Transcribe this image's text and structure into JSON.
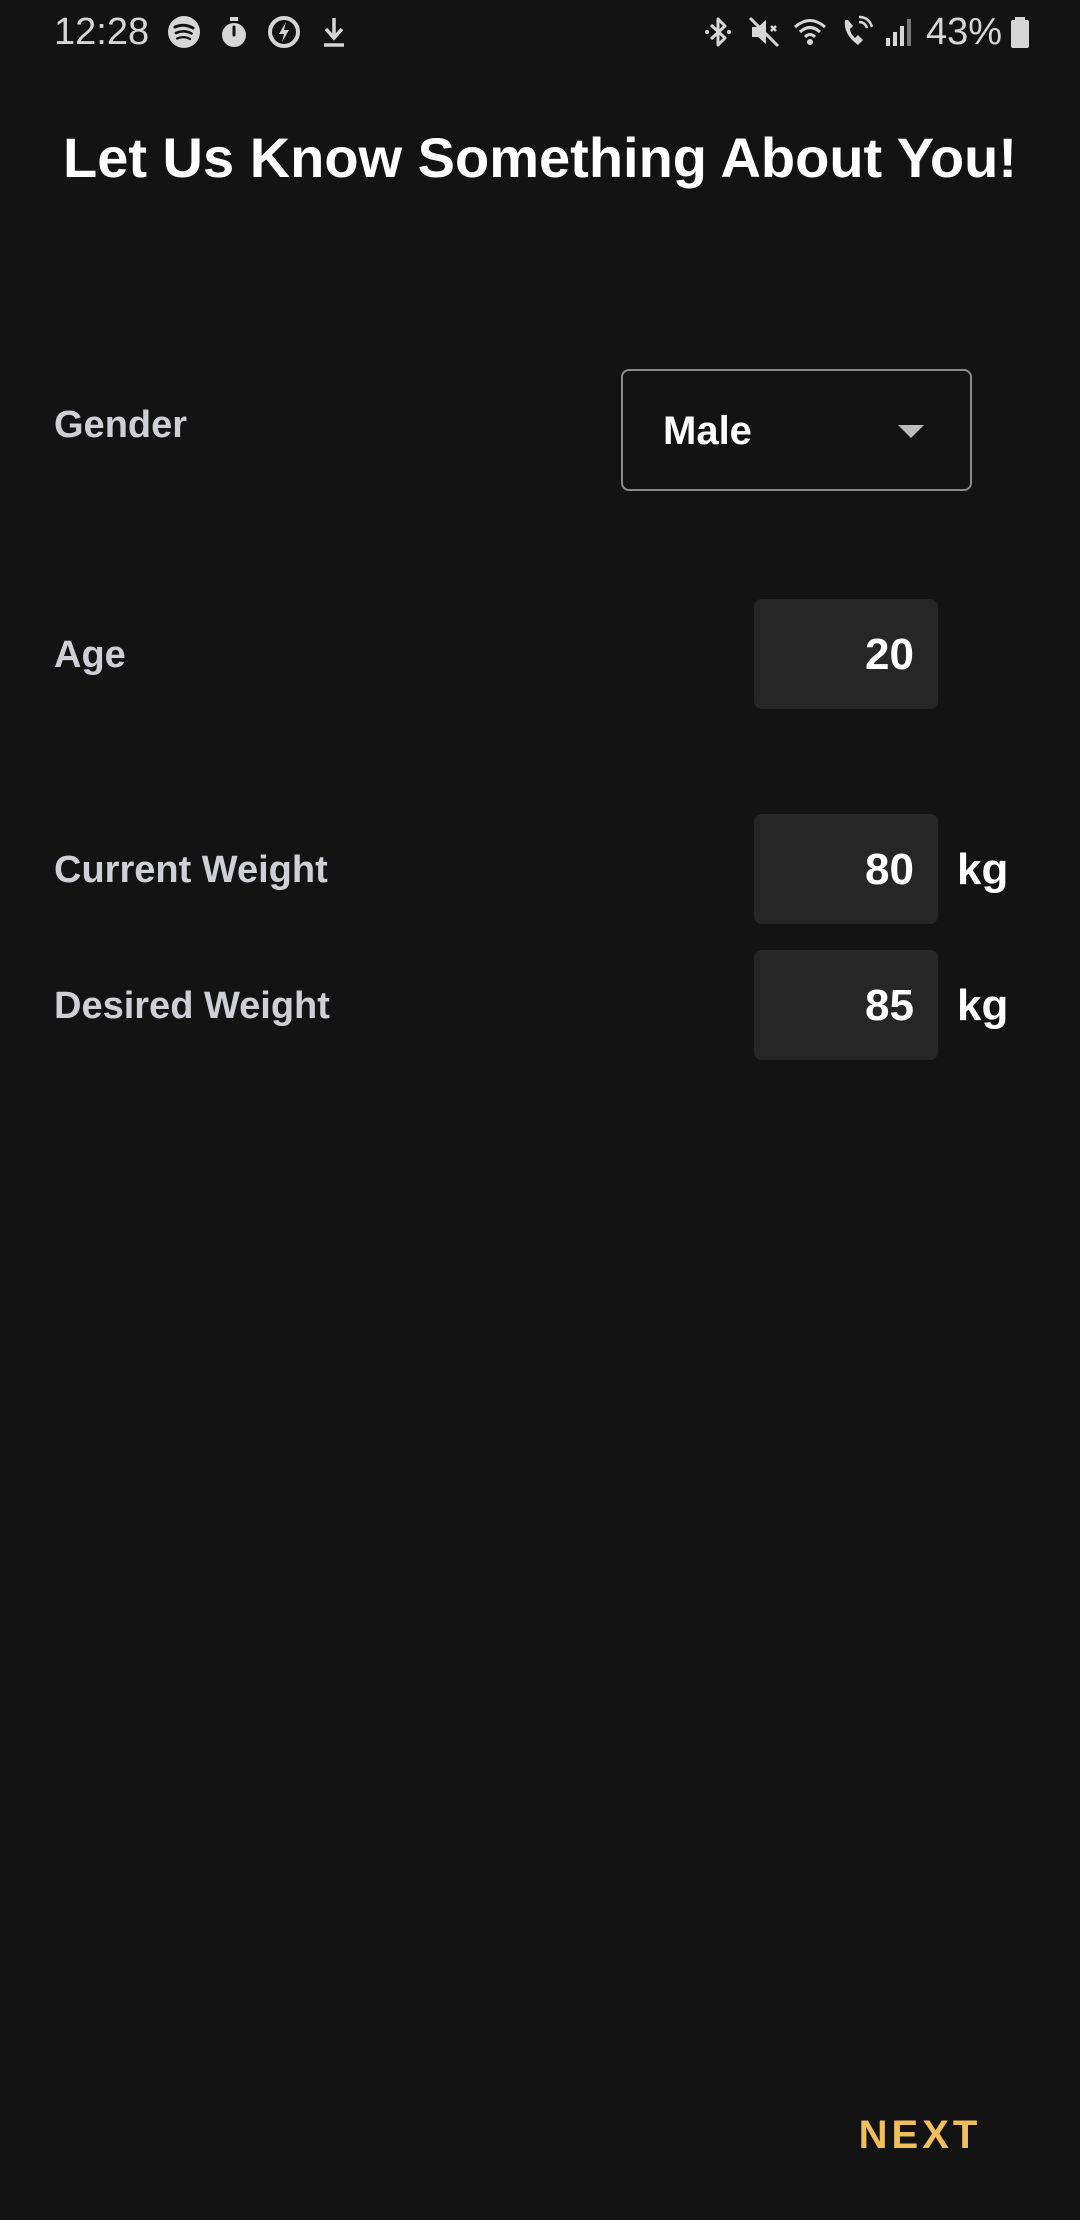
{
  "status_bar": {
    "time": "12:28",
    "battery_percent": "43%",
    "left_icons": [
      "spotify-icon",
      "timer-icon",
      "power-saving-icon",
      "download-icon"
    ],
    "right_icons": [
      "bluetooth-icon",
      "mute-icon",
      "wifi-icon",
      "wifi-calling-icon",
      "signal-icon",
      "battery-icon"
    ]
  },
  "header": {
    "title": "Let Us Know Something About You!"
  },
  "form": {
    "gender": {
      "label": "Gender",
      "selected": "Male"
    },
    "age": {
      "label": "Age",
      "value": "20"
    },
    "current_weight": {
      "label": "Current Weight",
      "value": "80",
      "unit": "kg"
    },
    "desired_weight": {
      "label": "Desired Weight",
      "value": "85",
      "unit": "kg"
    }
  },
  "footer": {
    "next_label": "NEXT"
  },
  "colors": {
    "background": "#131313",
    "field_background": "#262626",
    "accent": "#f0be5a",
    "label_text": "#cfcfd6"
  }
}
